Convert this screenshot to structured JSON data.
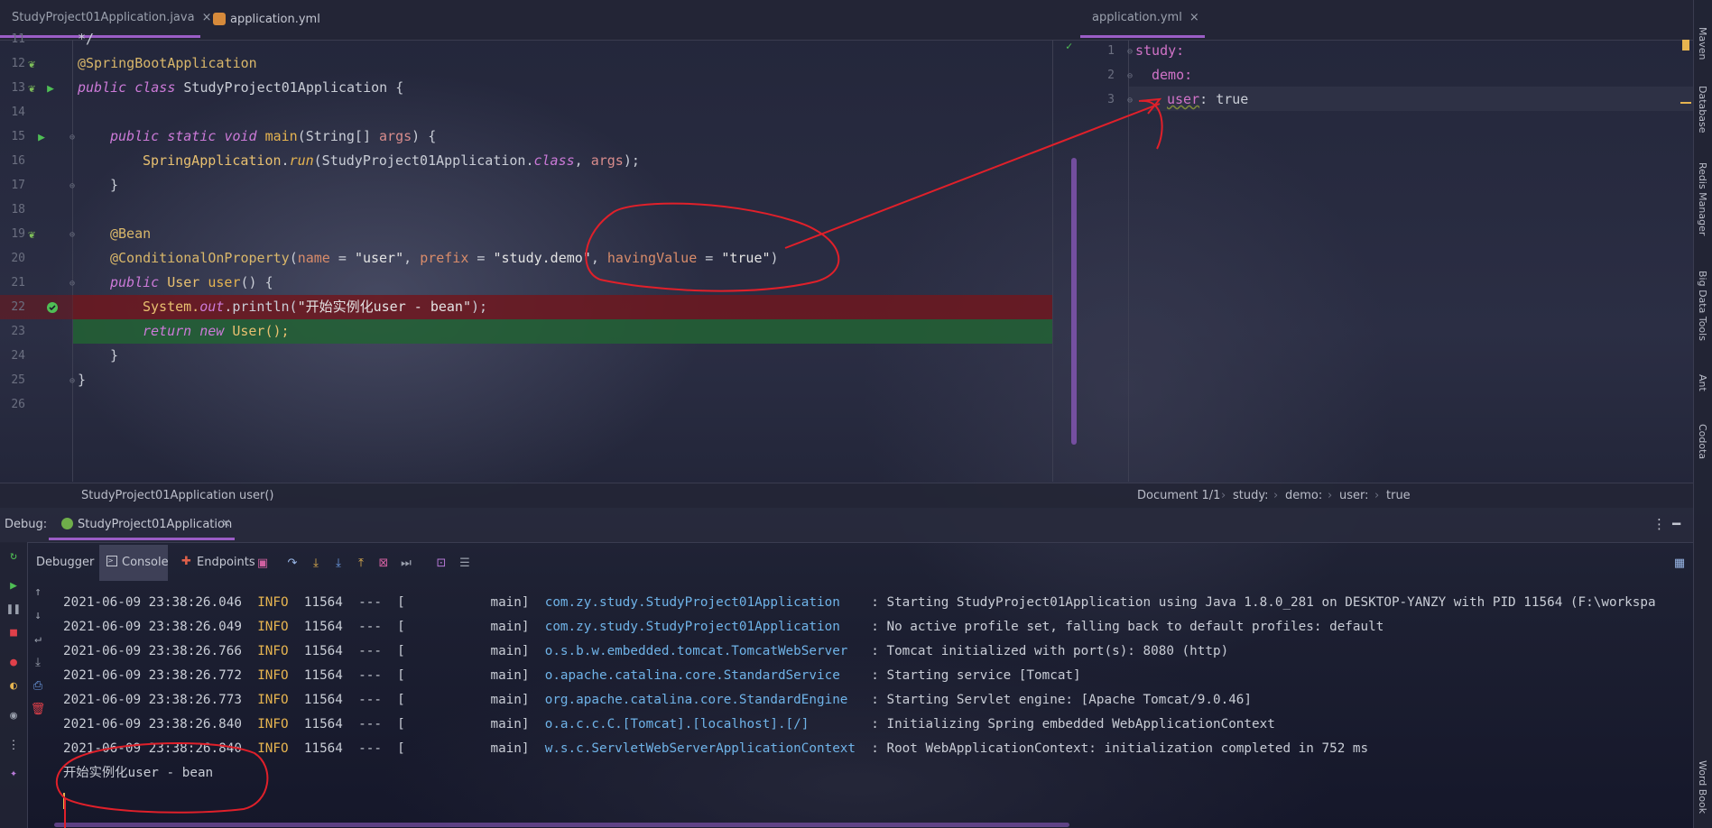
{
  "tabs_left": [
    {
      "label": "StudyProject01Application.java",
      "close": "×"
    },
    {
      "label": "application.yml",
      "close": ""
    }
  ],
  "tab_right": {
    "label": "application.yml",
    "close": "×"
  },
  "java_lines": [
    {
      "num": "11"
    },
    {
      "num": "12"
    },
    {
      "num": "13"
    },
    {
      "num": "14"
    },
    {
      "num": "15"
    },
    {
      "num": "16"
    },
    {
      "num": "17"
    },
    {
      "num": "18"
    },
    {
      "num": "19"
    },
    {
      "num": "20"
    },
    {
      "num": "21"
    },
    {
      "num": "22"
    },
    {
      "num": "23"
    },
    {
      "num": "24"
    },
    {
      "num": "25"
    },
    {
      "num": "26"
    }
  ],
  "code": {
    "l11": "*/",
    "l12_ann": "@SpringBootApplication",
    "l13_kw1": "public",
    "l13_kw2": "class",
    "l13_name": "StudyProject01Application {",
    "l15_kw1": "public",
    "l15_kw2": "static",
    "l15_kw3": "void",
    "l15_fn": "main",
    "l15_rest1": "(String[]",
    "l15_param": "args",
    "l15_rest2": ") {",
    "l16_cls": "SpringApplication",
    "l16_dot": ".",
    "l16_fn": "run",
    "l16_rest1": "(StudyProject01Application.",
    "l16_kw": "class",
    "l16_comma": ",",
    "l16_param": "args",
    "l16_end": ");",
    "l17": "}",
    "l19_ann": "@Bean",
    "l20_ann": "@ConditionalOnProperty",
    "l20_p1": "name",
    "l20_eq1": " = ",
    "l20_s1": "\"user\"",
    "l20_c1": ", ",
    "l20_p2": "prefix",
    "l20_eq2": " = ",
    "l20_s2": "\"study.demo\"",
    "l20_c2": ", ",
    "l20_p3": "havingValue",
    "l20_eq3": " = ",
    "l20_s3": "\"true\"",
    "l20_open": "(",
    "l20_close": ")",
    "l21_kw": "public",
    "l21_type": "User",
    "l21_fn": "user",
    "l21_rest": "() {",
    "l22_cls": "System.",
    "l22_out": "out",
    "l22_fn": ".println(",
    "l22_str": "\"开始实例化user - bean\"",
    "l22_end": ");",
    "l23_kw1": "return",
    "l23_kw2": "new",
    "l23_rest": "User();",
    "l24": "}",
    "l25": "}"
  },
  "yaml": {
    "nums": [
      "1",
      "2",
      "3"
    ],
    "l1": "study:",
    "l2": "demo:",
    "l3_key": "user",
    "l3_sep": ":",
    "l3_val": "true"
  },
  "breadcrumb_left": {
    "a": "StudyProject01Application",
    "b": "user()"
  },
  "breadcrumb_right": {
    "doc": "Document 1/1",
    "p1": "study:",
    "p2": "demo:",
    "p3": "user:",
    "p4": "true"
  },
  "debug": {
    "label": "Debug:",
    "session": "StudyProject01Application",
    "close": "×",
    "tab_debugger": "Debugger",
    "tab_console": "Console",
    "tab_endpoints": "Endpoints"
  },
  "console_lines": [
    {
      "ts": "2021-06-09 23:38:26.046",
      "lvl": "INFO",
      "pid": "11564",
      "dash": "---",
      "thread": "[           main]",
      "logger": "com.zy.study.StudyProject01Application  ",
      "msg": ": Starting StudyProject01Application using Java 1.8.0_281 on DESKTOP-YANZY with PID 11564 (F:\\workspa"
    },
    {
      "ts": "2021-06-09 23:38:26.049",
      "lvl": "INFO",
      "pid": "11564",
      "dash": "---",
      "thread": "[           main]",
      "logger": "com.zy.study.StudyProject01Application  ",
      "msg": ": No active profile set, falling back to default profiles: default"
    },
    {
      "ts": "2021-06-09 23:38:26.766",
      "lvl": "INFO",
      "pid": "11564",
      "dash": "---",
      "thread": "[           main]",
      "logger": "o.s.b.w.embedded.tomcat.TomcatWebServer ",
      "msg": ": Tomcat initialized with port(s): 8080 (http)"
    },
    {
      "ts": "2021-06-09 23:38:26.772",
      "lvl": "INFO",
      "pid": "11564",
      "dash": "---",
      "thread": "[           main]",
      "logger": "o.apache.catalina.core.StandardService  ",
      "msg": ": Starting service [Tomcat]"
    },
    {
      "ts": "2021-06-09 23:38:26.773",
      "lvl": "INFO",
      "pid": "11564",
      "dash": "---",
      "thread": "[           main]",
      "logger": "org.apache.catalina.core.StandardEngine ",
      "msg": ": Starting Servlet engine: [Apache Tomcat/9.0.46]"
    },
    {
      "ts": "2021-06-09 23:38:26.840",
      "lvl": "INFO",
      "pid": "11564",
      "dash": "---",
      "thread": "[           main]",
      "logger": "o.a.c.c.C.[Tomcat].[localhost].[/]      ",
      "msg": ": Initializing Spring embedded WebApplicationContext"
    },
    {
      "ts": "2021-06-09 23:38:26.840",
      "lvl": "INFO",
      "pid": "11564",
      "dash": "---",
      "thread": "[           main]",
      "logger": "w.s.c.ServletWebServerApplicationContext",
      "msg": ": Root WebApplicationContext: initialization completed in 752 ms"
    }
  ],
  "console_output": "开始实例化user - bean",
  "right_tools": [
    "Maven",
    "Database",
    "Redis Manager",
    "Big Data Tools",
    "Ant",
    "Codota",
    "Word Book"
  ],
  "colors": {
    "accent": "#9b5dc6",
    "breakpoint_line": "#5a1c22",
    "exec_line": "#1f4d2a",
    "annotation_ink": "#e0202a"
  }
}
